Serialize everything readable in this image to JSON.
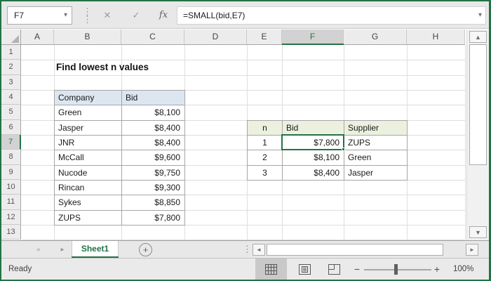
{
  "formula_bar": {
    "name_box_value": "F7",
    "formula": "=SMALL(bid,E7)",
    "fx_label": "fx"
  },
  "icons": {
    "cancel_glyph": "✕",
    "enter_glyph": "✓",
    "dropdown_glyph": "▾",
    "vdots_glyph": "⋮",
    "scroll_up_glyph": "▲",
    "scroll_down_glyph": "▼",
    "scroll_left_glyph": "◄",
    "scroll_right_glyph": "►",
    "tab_prev_glyph": "◂",
    "tab_next_glyph": "▸",
    "add_sheet_glyph": "+",
    "zoom_out_glyph": "−",
    "zoom_in_glyph": "+"
  },
  "grid": {
    "column_labels": [
      "A",
      "B",
      "C",
      "D",
      "E",
      "F",
      "G",
      "H"
    ],
    "row_labels": [
      "1",
      "2",
      "3",
      "4",
      "5",
      "6",
      "7",
      "8",
      "9",
      "10",
      "11",
      "12",
      "13"
    ],
    "selected_column": "F",
    "selected_row": "7"
  },
  "sheet": {
    "title": "Find lowest n values",
    "bids_table": {
      "headers": [
        "Company",
        "Bid"
      ],
      "rows": [
        [
          "Green",
          "$8,100"
        ],
        [
          "Jasper",
          "$8,400"
        ],
        [
          "JNR",
          "$8,400"
        ],
        [
          "McCall",
          "$9,600"
        ],
        [
          "Nucode",
          "$9,750"
        ],
        [
          "Rincan",
          "$9,300"
        ],
        [
          "Sykes",
          "$8,850"
        ],
        [
          "ZUPS",
          "$7,800"
        ]
      ]
    },
    "results_table": {
      "headers": [
        "n",
        "Bid",
        "Supplier"
      ],
      "rows": [
        [
          "1",
          "$7,800",
          "ZUPS"
        ],
        [
          "2",
          "$8,100",
          "Green"
        ],
        [
          "3",
          "$8,400",
          "Jasper"
        ]
      ]
    },
    "selected_cell": {
      "ref": "F7",
      "value": "$7,800"
    }
  },
  "tabs": {
    "sheet_tabs": [
      {
        "label": "Sheet1",
        "active": true
      }
    ]
  },
  "status_bar": {
    "mode": "Ready",
    "zoom_level": "100%"
  },
  "colors": {
    "accent_green": "#217346",
    "blue_header_fill": "#dce6f1",
    "green_header_fill": "#ebf1de",
    "selection_border": "#217346"
  }
}
